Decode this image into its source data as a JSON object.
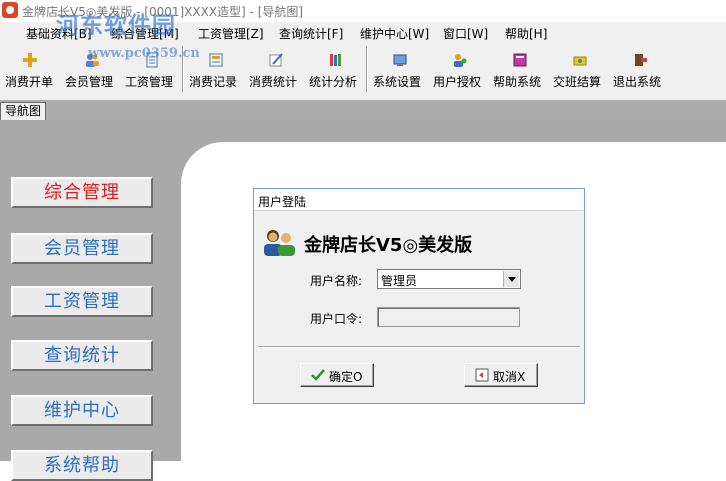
{
  "window": {
    "title": "金牌店长V5◎美发版 - [0001]XXXX造型] - [导航图]"
  },
  "watermark": {
    "site_name": "河东软件园",
    "url": "www.pc0359.cn"
  },
  "menubar": {
    "items": [
      "基础资料[B]",
      "综合管理[M]",
      "工资管理[Z]",
      "查询统计[F]",
      "维护中心[W]",
      "窗口[W]",
      "帮助[H]"
    ]
  },
  "toolbar": {
    "items": [
      {
        "label": "消费开单",
        "icon": "plus-icon"
      },
      {
        "label": "会员管理",
        "icon": "members-icon"
      },
      {
        "label": "工资管理",
        "icon": "document-icon"
      },
      {
        "label": "消费记录",
        "icon": "record-icon"
      },
      {
        "label": "消费统计",
        "icon": "pencil-icon"
      },
      {
        "label": "统计分析",
        "icon": "books-icon"
      },
      {
        "label": "系统设置",
        "icon": "settings-icon"
      },
      {
        "label": "用户授权",
        "icon": "users-icon"
      },
      {
        "label": "帮助系统",
        "icon": "help-book-icon"
      },
      {
        "label": "交班结算",
        "icon": "handover-icon"
      },
      {
        "label": "退出系统",
        "icon": "exit-icon"
      }
    ]
  },
  "tabs": {
    "active": "导航图"
  },
  "sidebar": {
    "items": [
      {
        "label": "综合管理",
        "active": true
      },
      {
        "label": "会员管理",
        "active": false
      },
      {
        "label": "工资管理",
        "active": false
      },
      {
        "label": "查询统计",
        "active": false
      },
      {
        "label": "维护中心",
        "active": false
      },
      {
        "label": "系统帮助",
        "active": false
      }
    ]
  },
  "login_dialog": {
    "title": "用户登陆",
    "heading": "金牌店长V5◎美发版",
    "username_label": "用户名称:",
    "username_value": "管理员",
    "password_label": "用户口令:",
    "password_value": "",
    "ok_label": "确定O",
    "cancel_label": "取消X"
  },
  "colors": {
    "sidebar_active_text": "#d81e1e",
    "sidebar_text": "#2a6fc0",
    "main_background": "#a9a9a9"
  }
}
